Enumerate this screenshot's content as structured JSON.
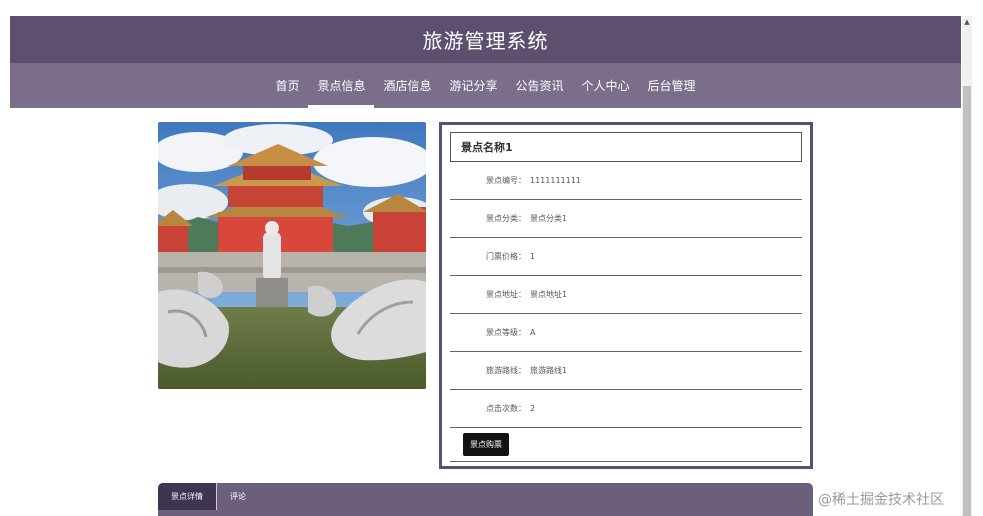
{
  "header": {
    "title": "旅游管理系统"
  },
  "nav": {
    "items": [
      {
        "label": "首页",
        "name": "nav-home"
      },
      {
        "label": "景点信息",
        "name": "nav-attractions",
        "active": true
      },
      {
        "label": "酒店信息",
        "name": "nav-hotels"
      },
      {
        "label": "游记分享",
        "name": "nav-travelogues"
      },
      {
        "label": "公告资讯",
        "name": "nav-announcements"
      },
      {
        "label": "个人中心",
        "name": "nav-profile"
      },
      {
        "label": "后台管理",
        "name": "nav-admin"
      }
    ]
  },
  "detail": {
    "title": "景点名称1",
    "fields": [
      {
        "label": "景点编号：",
        "value": "1111111111"
      },
      {
        "label": "景点分类：",
        "value": "景点分类1"
      },
      {
        "label": "门票价格：",
        "value": "1"
      },
      {
        "label": "景点地址：",
        "value": "景点地址1"
      },
      {
        "label": "景点等级：",
        "value": "A"
      },
      {
        "label": "旅游路线：",
        "value": "旅游路线1"
      },
      {
        "label": "点击次数：",
        "value": "2"
      }
    ],
    "buy_label": "景点购票"
  },
  "tabs": [
    {
      "label": "景点详情",
      "active": true
    },
    {
      "label": "评论",
      "active": false
    }
  ],
  "watermark": "@稀土掘金技术社区",
  "colors": {
    "header": "#5c4f6f",
    "nav": "#7b6e8a",
    "tabs": "#6b5f7d"
  }
}
